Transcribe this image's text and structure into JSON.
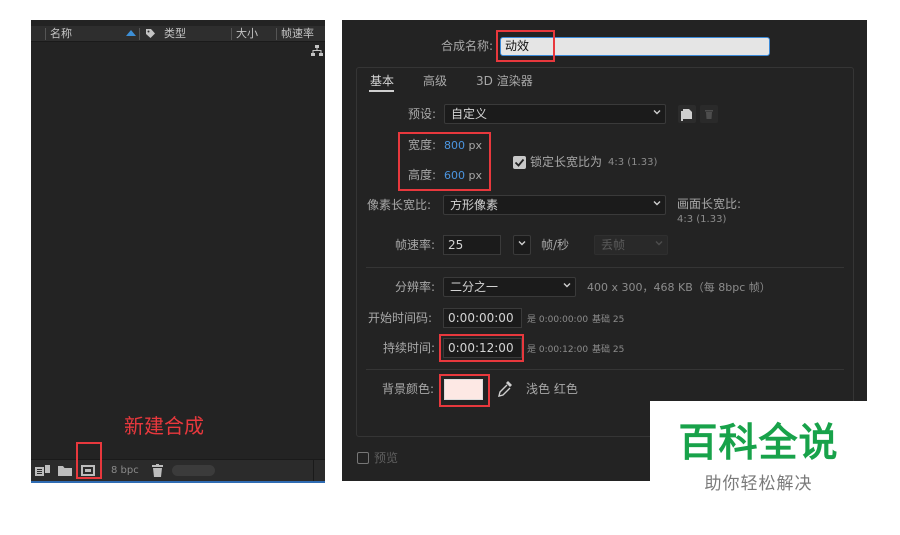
{
  "project_panel": {
    "columns": {
      "name": "名称",
      "type": "类型",
      "size": "大小",
      "frame_rate": "帧速率"
    },
    "footer": {
      "bpc": "8 bpc"
    },
    "annotation": "新建合成"
  },
  "dialog": {
    "comp_name_label": "合成名称:",
    "comp_name_value": "动效",
    "tabs": [
      "基本",
      "高级",
      "3D 渲染器"
    ],
    "preset_label": "预设:",
    "preset_value": "自定义",
    "width_label": "宽度:",
    "width_value": "800",
    "height_label": "高度:",
    "height_value": "600",
    "unit_px": "px",
    "lock_aspect_label": "锁定长宽比为",
    "lock_aspect_value": "4:3 (1.33)",
    "lock_aspect_checked": true,
    "pixel_aspect_label": "像素长宽比:",
    "pixel_aspect_value": "方形像素",
    "frame_aspect_label": "画面长宽比:",
    "frame_aspect_value": "4:3 (1.33)",
    "frame_rate_label": "帧速率:",
    "frame_rate_value": "25",
    "frame_rate_unit": "帧/秒",
    "drop_frame_value": "丢帧",
    "resolution_label": "分辨率:",
    "resolution_value": "二分之一",
    "resolution_info": "400 x 300，468 KB（每 8bpc 帧）",
    "start_tc_label": "开始时间码:",
    "start_tc_value": "0:00:00:00",
    "start_tc_info": "是 0:00:00:00",
    "start_tc_base": "基础 25",
    "duration_label": "持续时间:",
    "duration_value": "0:00:12:00",
    "duration_info": "是 0:00:12:00",
    "duration_base": "基础 25",
    "bg_color_label": "背景颜色:",
    "bg_color_name": "浅色 红色",
    "bg_color_hex": "#fde8e4",
    "preview_label": "预览",
    "preview_checked": false
  },
  "watermark": {
    "title": "百科全说",
    "subtitle": "助你轻松解决"
  },
  "colors": {
    "panel_bg": "#232323",
    "highlight_red": "#e8383d",
    "value_blue": "#4b95e0",
    "watermark_green": "#18a24a"
  }
}
